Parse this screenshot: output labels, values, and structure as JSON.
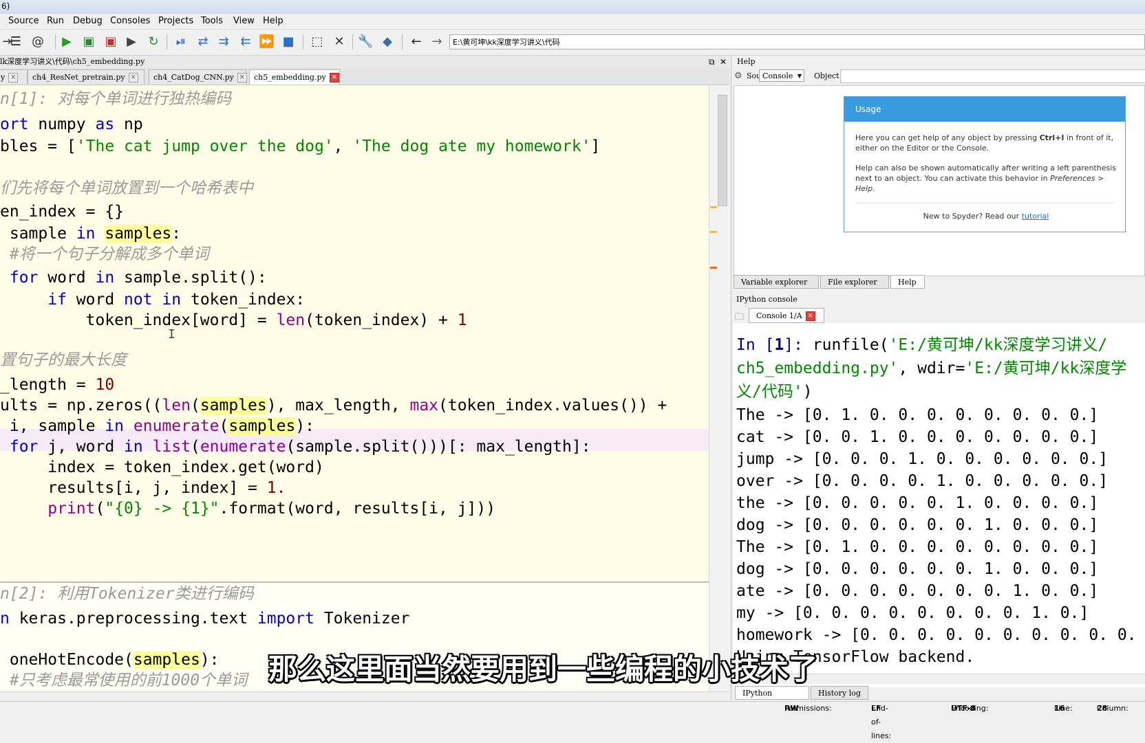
{
  "window": {
    "title_fragment": "6)"
  },
  "menu": [
    "Source",
    "Run",
    "Debug",
    "Consoles",
    "Projects",
    "Tools",
    "View",
    "Help"
  ],
  "toolbar": {
    "path": "E:\\黄可坤\\kk深度学习讲义\\代码"
  },
  "editor": {
    "path": "lk深度学习讲义\\代码\\ch5_embedding.py",
    "tabs": [
      {
        "label": "y"
      },
      {
        "label": "ch4_ResNet_pretrain.py"
      },
      {
        "label": "ch4_CatDog_CNN.py"
      },
      {
        "label": "ch5_embedding.py"
      }
    ]
  },
  "code": {
    "l1": "n[1]: 对每个单词进行独热编码",
    "l2_a": "ort",
    "l2_b": " numpy ",
    "l2_c": "as",
    "l2_d": " np",
    "l3_a": "bles = [",
    "l3_b": "'The cat jump over the dog'",
    "l3_c": ", ",
    "l3_d": "'The dog ate my homework'",
    "l3_e": "]",
    "l4": "们先将每个单词放置到一个哈希表中",
    "l5": "en_index = {}",
    "l6_a": " sample ",
    "l6_b": "in",
    "l6_c": " ",
    "l6_d": "samples",
    "l6_e": ":",
    "l7": " #将一个句子分解成多个单词",
    "l8_a": " for",
    "l8_b": " word ",
    "l8_c": "in",
    "l8_d": " sample.split():",
    "l9_a": "     if",
    "l9_b": " word ",
    "l9_c": "not in",
    "l9_d": " token_index:",
    "l10_a": "         token_index[word] = ",
    "l10_b": "len",
    "l10_c": "(token_index) + ",
    "l10_d": "1",
    "l11": "置句子的最大长度",
    "l12_a": "_length = ",
    "l12_b": "10",
    "l13_a": "ults = np.zeros((",
    "l13_b": "len",
    "l13_c": "(",
    "l13_d": "samples",
    "l13_e": "), max_length, ",
    "l13_f": "max",
    "l13_g": "(token_index.values()) +",
    "l14_a": " i, sample ",
    "l14_b": "in",
    "l14_c": " ",
    "l14_d": "enumerate",
    "l14_e": "(",
    "l14_f": "samples",
    "l14_g": "):",
    "l15_a": " for",
    "l15_b": " j, word ",
    "l15_c": "in",
    "l15_d": " ",
    "l15_e": "list",
    "l15_f": "(",
    "l15_g": "enumerate",
    "l15_h": "(sample.split()))[: max_length]:",
    "l16": "     index = token_index.get(word)",
    "l17_a": "     results[i, j, index] = ",
    "l17_b": "1.",
    "l18_a": "     ",
    "l18_b": "print",
    "l18_c": "(",
    "l18_d": "\"{0} -> {1}\"",
    "l18_e": ".format(word, results[i, j]))",
    "l19": "n[2]: 利用Tokenizer类进行编码",
    "l20_a": "n",
    "l20_b": " keras.preprocessing.text ",
    "l20_c": "import",
    "l20_d": " Tokenizer",
    "l21_a": " oneHotEncode(",
    "l21_b": "samples",
    "l21_c": "):",
    "l22": " #只考虑最常使用的前1000个单词"
  },
  "help": {
    "title": "Help",
    "source_label": "Source",
    "source_value": "Console",
    "object_label": "Object",
    "usage_title": "Usage",
    "usage_p1_a": "Here you can get help of any object by pressing ",
    "usage_p1_b": "Ctrl+I",
    "usage_p1_c": " in front of it, either on the Editor or the Console.",
    "usage_p2_a": "Help can also be shown automatically after writing a left parenthesis next to an object. You can activate this behavior in ",
    "usage_p2_b": "Preferences > Help",
    "usage_p2_c": ".",
    "new_text": "New to Spyder? Read our ",
    "tutorial": "tutorial",
    "tabs": [
      "Variable explorer",
      "File explorer",
      "Help"
    ]
  },
  "console": {
    "pane_title": "IPython console",
    "tab_label": "Console 1/A",
    "in1_prompt": "In [",
    "in1_num": "1",
    "in1_close": "]: ",
    "in1_a": "runfile(",
    "in1_b": "'E:/黄可坤/kk深度学习讲义/",
    "in1_c": "ch5_embedding.py'",
    "in1_d": ", wdir=",
    "in1_e": "'E:/黄可坤/kk深度学",
    "in1_f": "义/代码'",
    "in1_g": ")",
    "output": [
      "The -> [0. 1. 0. 0. 0. 0. 0. 0. 0. 0.]",
      "cat -> [0. 0. 1. 0. 0. 0. 0. 0. 0. 0.]",
      "jump -> [0. 0. 0. 1. 0. 0. 0. 0. 0. 0.]",
      "over -> [0. 0. 0. 0. 1. 0. 0. 0. 0. 0.]",
      "the -> [0. 0. 0. 0. 0. 1. 0. 0. 0. 0.]",
      "dog -> [0. 0. 0. 0. 0. 0. 1. 0. 0. 0.]",
      "The -> [0. 1. 0. 0. 0. 0. 0. 0. 0. 0.]",
      "dog -> [0. 0. 0. 0. 0. 0. 1. 0. 0. 0.]",
      "ate -> [0. 0. 0. 0. 0. 0. 0. 1. 0. 0.]",
      "my -> [0. 0. 0. 0. 0. 0. 0. 0. 1. 0.]",
      "homework -> [0. 0. 0. 0. 0. 0. 0. 0. 0. 0.",
      "Using TensorFlow backend."
    ],
    "bottom_tabs": [
      "IPython console",
      "History log"
    ]
  },
  "status": {
    "permissions_label": "Permissions:",
    "permissions": "RW",
    "eol_label": "End-of-lines:",
    "eol": "LF",
    "encoding_label": "Encoding:",
    "encoding": "UTF-8",
    "line_label": "Line:",
    "line": "16",
    "column_label": "Column:",
    "column": "28"
  },
  "subtitle": "那么这里面当然要用到一些编程的小技术了",
  "colors": {
    "editor_bg": "#fffde7",
    "highlight": "#ffff99",
    "keyword": "#0000cc",
    "string": "#008800",
    "comment": "#9a9a9a",
    "usage_header": "#3a9ae0"
  }
}
